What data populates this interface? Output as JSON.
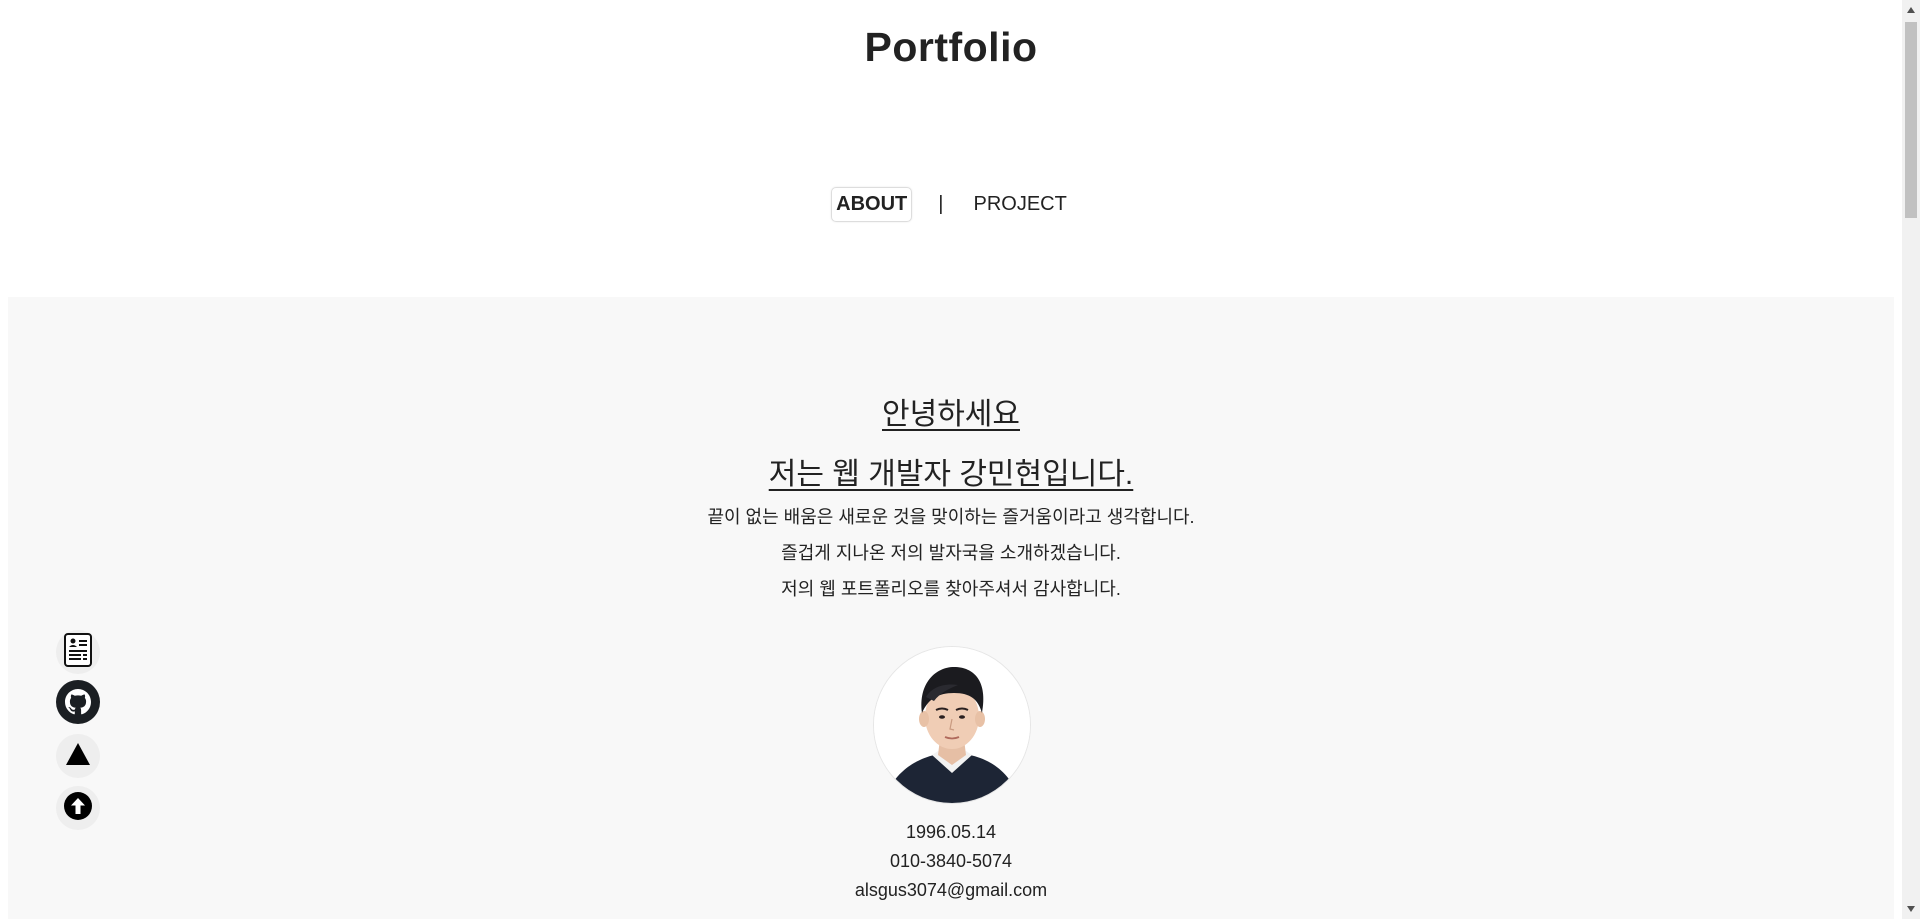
{
  "header": {
    "title": "Portfolio"
  },
  "nav": {
    "items": [
      {
        "label": "ABOUT",
        "active": true
      },
      {
        "label": "PROJECT",
        "active": false
      }
    ],
    "separator": "|"
  },
  "about": {
    "greeting_line1": "안녕하세요",
    "greeting_line2": "저는 웹 개발자 강민현입니다.",
    "intro": [
      "끝이 없는 배움은 새로운 것을 맞이하는 즐거움이라고 생각합니다.",
      "즐겁게 지나온 저의 발자국을 소개하겠습니다.",
      "저의 웹 포트폴리오를 찾아주셔서 감사합니다."
    ],
    "birthdate": "1996.05.14",
    "phone": "010-3840-5074",
    "email": "alsgus3074@gmail.com"
  },
  "floating_buttons": [
    {
      "icon": "resume-icon"
    },
    {
      "icon": "github-icon"
    },
    {
      "icon": "vercel-icon"
    },
    {
      "icon": "arrow-up-icon"
    }
  ],
  "colors": {
    "background": "#ffffff",
    "section_background": "#f8f8f8",
    "text": "#222222",
    "button_background": "#eeeeee"
  }
}
